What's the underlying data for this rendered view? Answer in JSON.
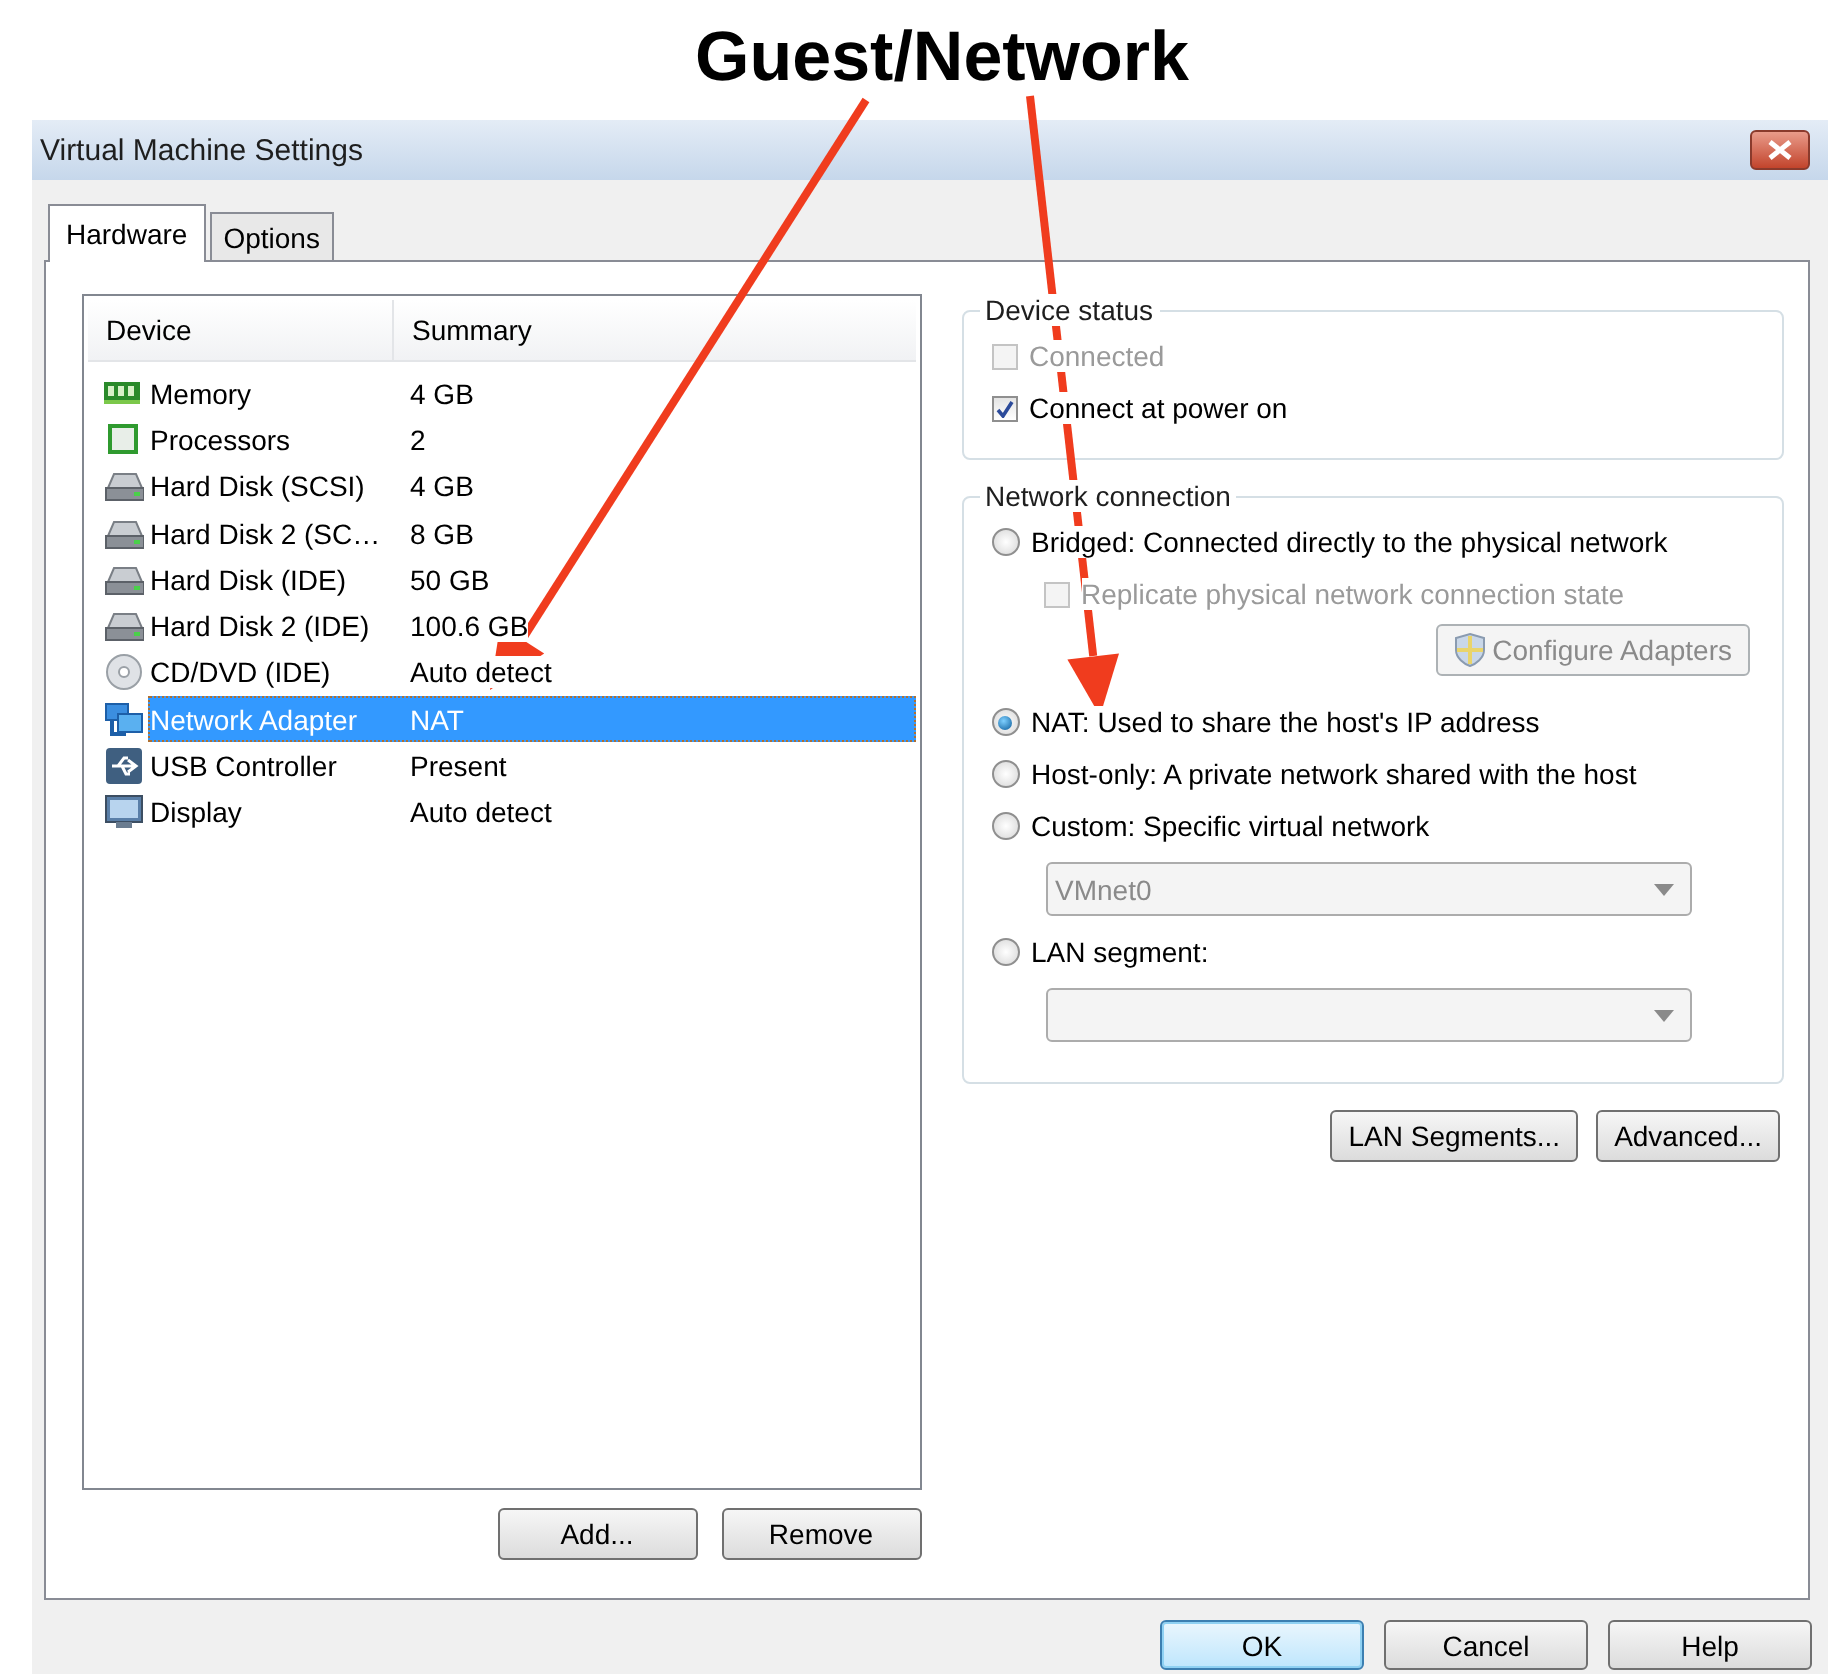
{
  "annotation": {
    "label": "Guest/Network"
  },
  "window": {
    "title": "Virtual Machine Settings"
  },
  "tabs": [
    {
      "label": "Hardware",
      "selected": true
    },
    {
      "label": "Options",
      "selected": false
    }
  ],
  "device_list": {
    "columns": [
      "Device",
      "Summary"
    ],
    "rows": [
      {
        "kind": "memory",
        "device": "Memory",
        "summary": "4 GB",
        "selected": false
      },
      {
        "kind": "processor",
        "device": "Processors",
        "summary": "2",
        "selected": false
      },
      {
        "kind": "disk",
        "device": "Hard Disk (SCSI)",
        "summary": "4 GB",
        "selected": false
      },
      {
        "kind": "disk",
        "device": "Hard Disk 2 (SC…",
        "summary": "8 GB",
        "selected": false
      },
      {
        "kind": "disk",
        "device": "Hard Disk (IDE)",
        "summary": "50 GB",
        "selected": false
      },
      {
        "kind": "disk",
        "device": "Hard Disk 2 (IDE)",
        "summary": "100.6 GB",
        "selected": false
      },
      {
        "kind": "cd",
        "device": "CD/DVD (IDE)",
        "summary": "Auto detect",
        "selected": false
      },
      {
        "kind": "network",
        "device": "Network Adapter",
        "summary": "NAT",
        "selected": true
      },
      {
        "kind": "usb",
        "device": "USB Controller",
        "summary": "Present",
        "selected": false
      },
      {
        "kind": "display",
        "device": "Display",
        "summary": "Auto detect",
        "selected": false
      }
    ]
  },
  "list_buttons": [
    "Add...",
    "Remove"
  ],
  "device_status": {
    "title": "Device status",
    "items": [
      {
        "kind": "checkbox",
        "label": "Connected",
        "checked": false,
        "disabled": true
      },
      {
        "kind": "checkbox",
        "label": "Connect at power on",
        "checked": true,
        "disabled": false
      }
    ]
  },
  "network_connection": {
    "title": "Network connection",
    "items": [
      {
        "kind": "radio",
        "label": "Bridged: Connected directly to the physical network",
        "selected": false
      },
      {
        "kind": "checkbox",
        "label": "Replicate physical network connection state",
        "checked": false,
        "disabled": true
      },
      {
        "kind": "button",
        "label": "Configure Adapters",
        "disabled": true
      },
      {
        "kind": "radio",
        "label": "NAT: Used to share the host's IP address",
        "selected": true
      },
      {
        "kind": "radio",
        "label": "Host-only: A private network shared with the host",
        "selected": false
      },
      {
        "kind": "radio",
        "label": "Custom: Specific virtual network",
        "selected": false
      },
      {
        "kind": "dropdown",
        "value": "VMnet0",
        "disabled": true
      },
      {
        "kind": "radio",
        "label": "LAN segment:",
        "selected": false
      },
      {
        "kind": "dropdown",
        "disabled": true
      }
    ]
  },
  "network_buttons": [
    "LAN Segments...",
    "Advanced..."
  ],
  "dialog_buttons": [
    {
      "label": "OK",
      "default": true
    },
    {
      "label": "Cancel",
      "default": false
    },
    {
      "label": "Help",
      "default": false
    }
  ]
}
